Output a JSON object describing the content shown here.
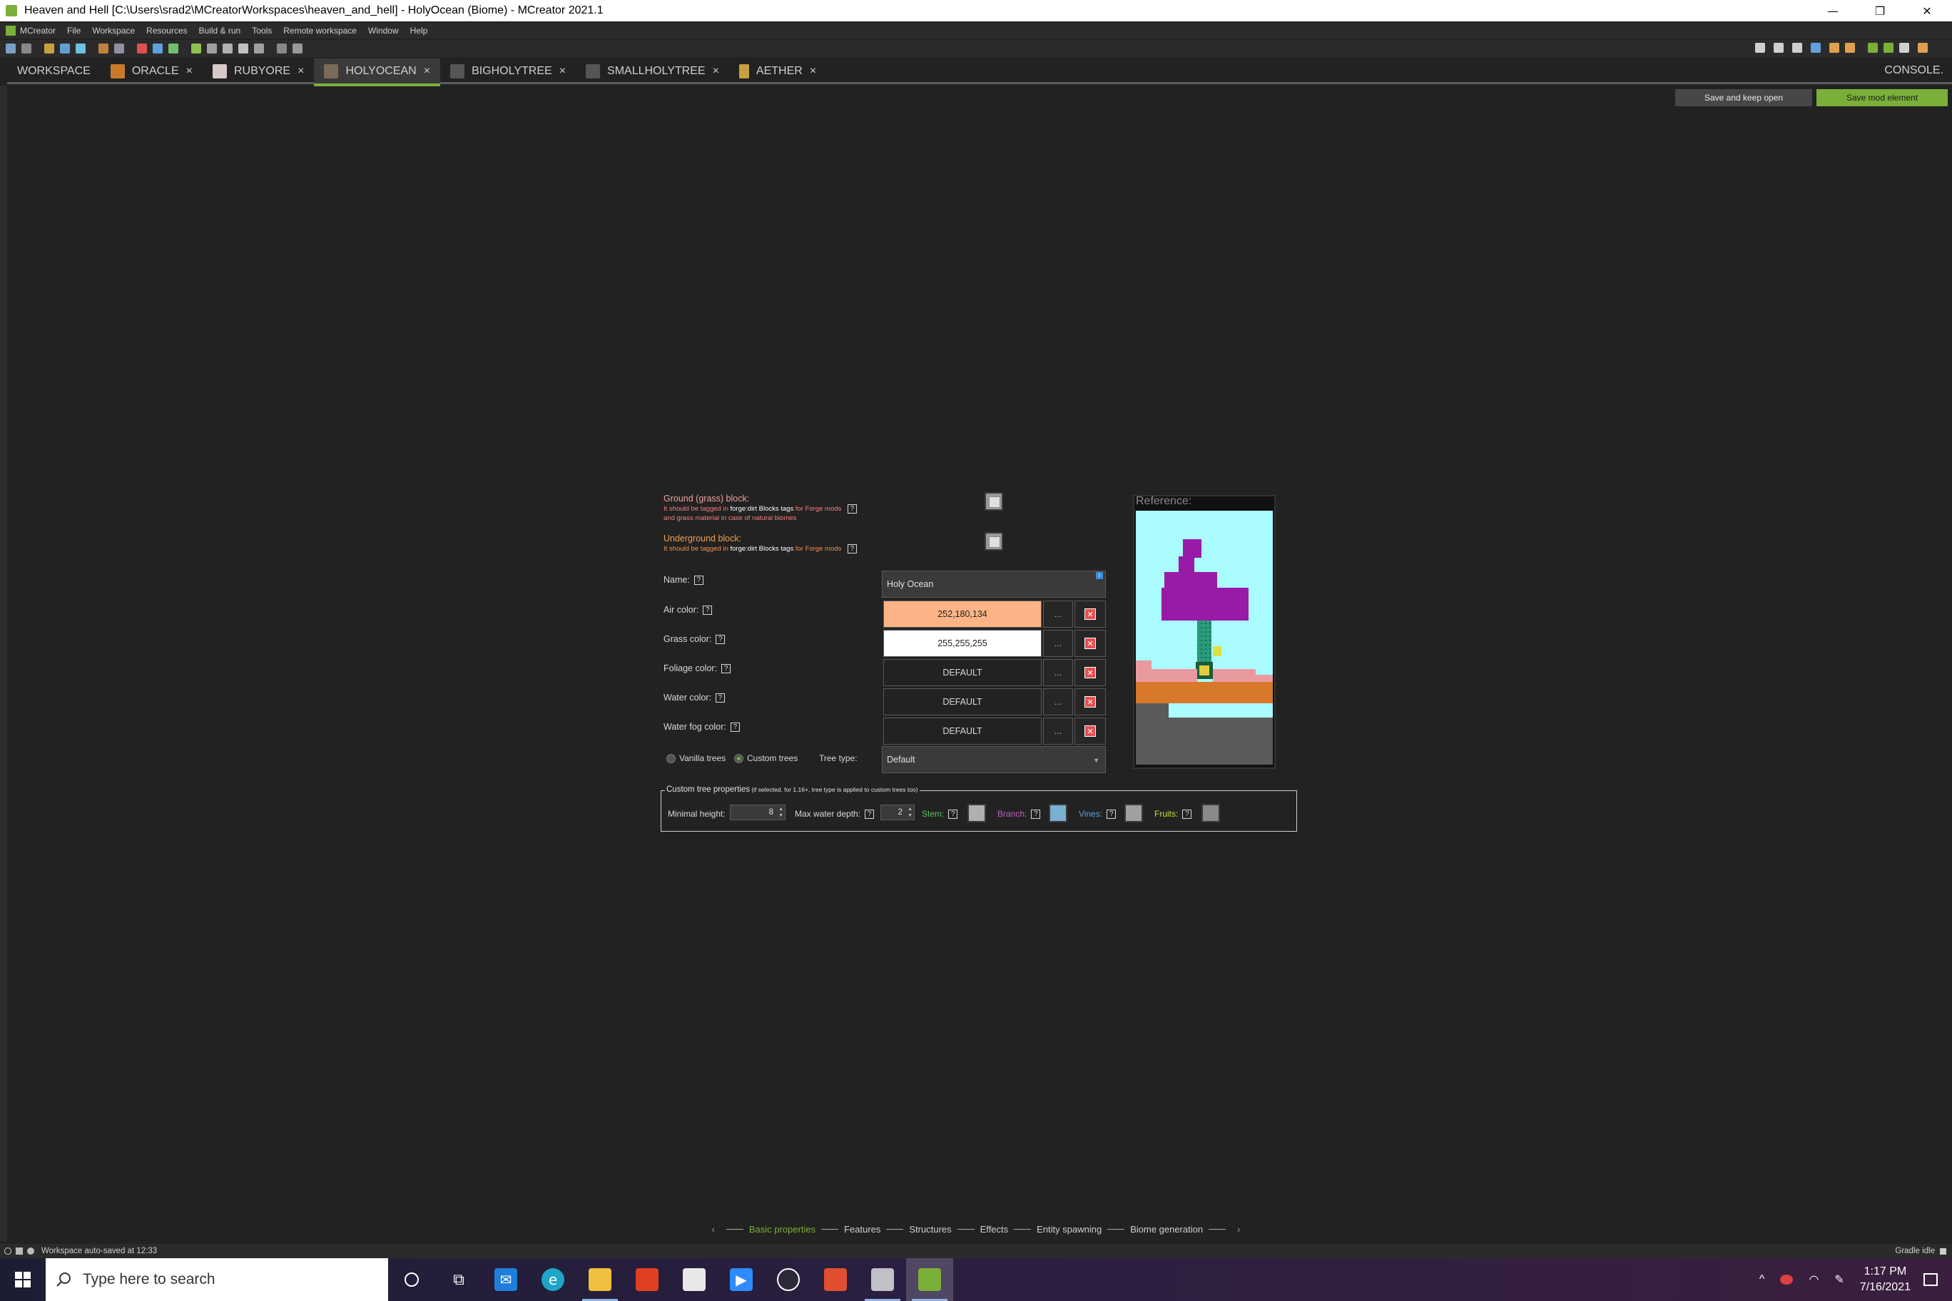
{
  "window": {
    "title": "Heaven and Hell [C:\\Users\\srad2\\MCreatorWorkspaces\\heaven_and_hell] - HolyOcean (Biome) - MCreator 2021.1",
    "minimize": "—",
    "restore": "❐",
    "close": "✕"
  },
  "menu": {
    "items": [
      "MCreator",
      "File",
      "Workspace",
      "Resources",
      "Build & run",
      "Tools",
      "Remote workspace",
      "Window",
      "Help"
    ]
  },
  "tabs": [
    {
      "label": "WORKSPACE",
      "close": "",
      "icon_color": ""
    },
    {
      "label": "ORACLE",
      "close": "×",
      "icon_color": "#c87a2a"
    },
    {
      "label": "RUBYORE",
      "close": "×",
      "icon_color": "#d8c8c8"
    },
    {
      "label": "HOLYOCEAN",
      "close": "×",
      "icon_color": "#7a6a5a"
    },
    {
      "label": "BIGHOLYTREE",
      "close": "×",
      "icon_color": "#555555"
    },
    {
      "label": "SMALLHOLYTREE",
      "close": "×",
      "icon_color": "#555555"
    },
    {
      "label": "AETHER",
      "close": "×",
      "icon_color": "#c8a040"
    }
  ],
  "console_label": "CONSOLE.",
  "actions": {
    "save_keep_open": "Save and keep open",
    "save_mod_element": "Save mod element"
  },
  "form": {
    "ground_block": {
      "label": "Ground (grass) block:",
      "hint1_pre": "It should be tagged in ",
      "hint1_tag": "forge:dirt Blocks tags",
      "hint1_post": " for Forge mods",
      "hint2": "and grass material in case of natural biomes"
    },
    "underground_block": {
      "label": "Underground block:",
      "hint_pre": "It should be tagged in ",
      "hint_tag": "forge:dirt Blocks tags",
      "hint_post": " for Forge mods"
    },
    "name_label": "Name:",
    "name_value": "Holy Ocean",
    "air_color_label": "Air color:",
    "air_color_value": "252,180,134",
    "air_color_hex": "#fcb486",
    "grass_color_label": "Grass color:",
    "grass_color_value": "255,255,255",
    "grass_color_hex": "#ffffff",
    "foliage_color_label": "Foliage color:",
    "foliage_color_value": "DEFAULT",
    "water_color_label": "Water color:",
    "water_color_value": "DEFAULT",
    "water_fog_color_label": "Water fog color:",
    "water_fog_color_value": "DEFAULT",
    "dots": "...",
    "clear": "✕",
    "vanilla_trees": "Vanilla trees",
    "custom_trees": "Custom trees",
    "tree_type_label": "Tree type:",
    "tree_type_value": "Default",
    "help": "?"
  },
  "reference": {
    "label": "Reference:"
  },
  "custom_tree": {
    "title": "Custom tree properties",
    "title_note": " (if selected, for 1.16+, tree type is applied to custom trees too)",
    "minimal_height_label": "Minimal height:",
    "minimal_height_value": "8",
    "max_water_depth_label": "Max water depth:",
    "max_water_depth_value": "2",
    "stem_label": "Stem:",
    "branch_label": "Branch:",
    "vines_label": "Vines:",
    "fruits_label": "Fruits:",
    "stem_color": "#5bbf5b",
    "branch_color": "#c060c0",
    "vines_color": "#60a0e0",
    "fruits_color": "#c0e040"
  },
  "bottom_nav": {
    "pages": [
      "Basic properties",
      "Features",
      "Structures",
      "Effects",
      "Entity spawning",
      "Biome generation"
    ],
    "active": "Basic properties",
    "prev": "‹",
    "next": "›"
  },
  "status": {
    "left": "Workspace auto-saved at 12:33",
    "right": "Gradle idle"
  },
  "taskbar": {
    "search_placeholder": "Type here to search",
    "time": "1:17 PM",
    "date": "7/16/2021"
  }
}
